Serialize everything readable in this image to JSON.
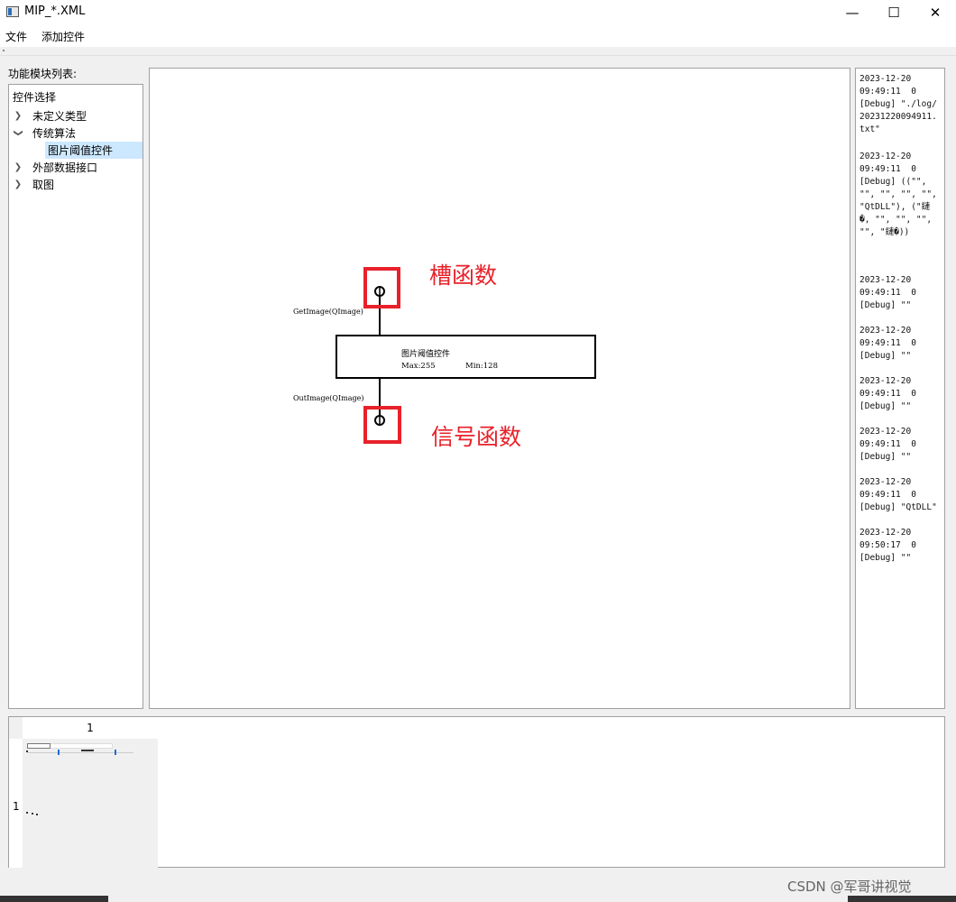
{
  "window": {
    "title": "MIP_*.XML",
    "minimize_glyph": "—",
    "maximize_glyph": "☐",
    "close_glyph": "✕"
  },
  "menu": {
    "items": [
      "文件",
      "添加控件"
    ]
  },
  "left_panel": {
    "label": "功能模块列表:",
    "tree_header": "控件选择",
    "items": [
      {
        "label": "未定义类型",
        "state": "collapsed"
      },
      {
        "label": "传统算法",
        "state": "expanded"
      },
      {
        "label": "图片阈值控件",
        "state": "child-selected"
      },
      {
        "label": "外部数据接口",
        "state": "collapsed"
      },
      {
        "label": "取图",
        "state": "collapsed"
      }
    ]
  },
  "canvas": {
    "node": {
      "title": "图片阈值控件",
      "max_text": "Max:255",
      "min_text": "Min:128"
    },
    "input_port_label": "GetImage(QImage)",
    "output_port_label": "OutImage(QImage)",
    "annotation_slot": "槽函数",
    "annotation_signal": "信号函数",
    "annotation_color": "#e8212a"
  },
  "log": {
    "entries": [
      "2023-12-20\n09:49:11  0\n[Debug] \"./log/\n20231220094911.\ntxt\"",
      "2023-12-20\n09:49:11  0\n[Debug] ((\"\",\n\"\", \"\", \"\", \"\",\n\"QtDLL\"), (\"鏈\n�, \"\", \"\", \"\",\n\"\", \"鏈�))",
      "2023-12-20\n09:49:11  0\n[Debug] \"\"",
      "2023-12-20\n09:49:11  0\n[Debug] \"\"",
      "2023-12-20\n09:49:11  0\n[Debug] \"\"",
      "2023-12-20\n09:49:11  0\n[Debug] \"\"",
      "2023-12-20\n09:49:11  0\n[Debug] \"QtDLL\"",
      "2023-12-20\n09:50:17  0\n[Debug] \"\""
    ]
  },
  "bottom_table": {
    "column_header": "1",
    "row_header": "1"
  },
  "watermark": "CSDN @军哥讲视觉"
}
